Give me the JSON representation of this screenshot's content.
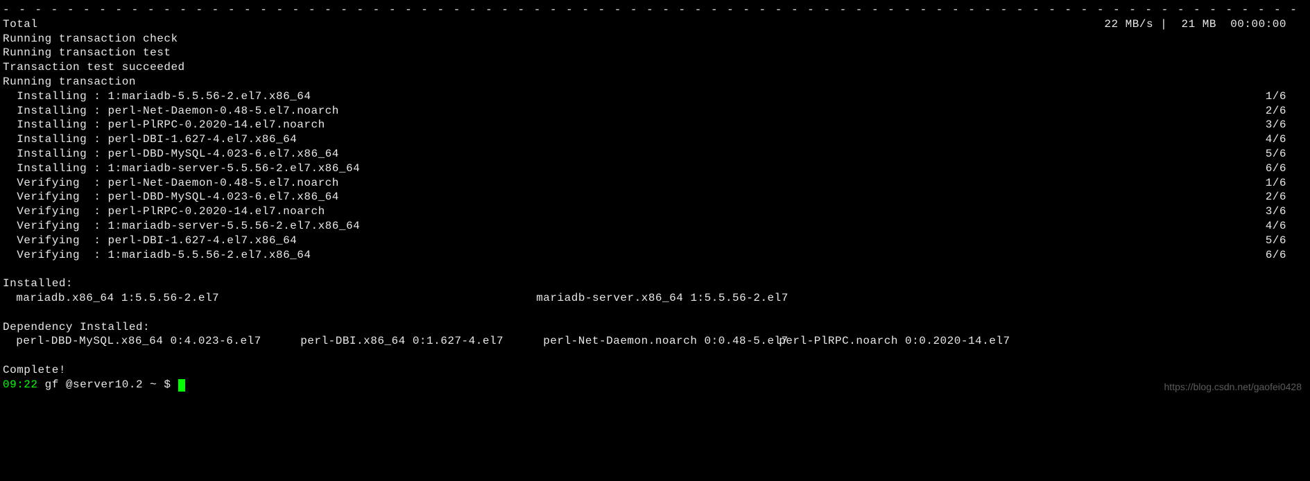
{
  "divider": "- - - - - - - - - - - - - - - - - - - - - - - - - - - - - - - - - - - - - - - - - - - - - - - - - - - - - - - - - - - - - - - - - - - - - - - - - - - - - - - - - - - - - - - - - - - - - - - - - - - - - - - - - - - - - - - - - - - - - - - - - - - - - - - - - - - - - - - - - - - - - - - - - - - - - - - - - - - - - - - - - - - - - - - - - - - - - - - - - - - - - - - - - - - - - - - - - - - - - - - - - - - - - - - - - - - - - - - - - - - - - -",
  "total": {
    "label": "Total",
    "stats": "22 MB/s |  21 MB  00:00:00"
  },
  "status": {
    "check": "Running transaction check",
    "test": "Running transaction test",
    "succeeded": "Transaction test succeeded",
    "running": "Running transaction"
  },
  "install": [
    {
      "left": "  Installing : 1:mariadb-5.5.56-2.el7.x86_64",
      "right": "1/6"
    },
    {
      "left": "  Installing : perl-Net-Daemon-0.48-5.el7.noarch",
      "right": "2/6"
    },
    {
      "left": "  Installing : perl-PlRPC-0.2020-14.el7.noarch",
      "right": "3/6"
    },
    {
      "left": "  Installing : perl-DBI-1.627-4.el7.x86_64",
      "right": "4/6"
    },
    {
      "left": "  Installing : perl-DBD-MySQL-4.023-6.el7.x86_64",
      "right": "5/6"
    },
    {
      "left": "  Installing : 1:mariadb-server-5.5.56-2.el7.x86_64",
      "right": "6/6"
    }
  ],
  "verify": [
    {
      "left": "  Verifying  : perl-Net-Daemon-0.48-5.el7.noarch",
      "right": "1/6"
    },
    {
      "left": "  Verifying  : perl-DBD-MySQL-4.023-6.el7.x86_64",
      "right": "2/6"
    },
    {
      "left": "  Verifying  : perl-PlRPC-0.2020-14.el7.noarch",
      "right": "3/6"
    },
    {
      "left": "  Verifying  : 1:mariadb-server-5.5.56-2.el7.x86_64",
      "right": "4/6"
    },
    {
      "left": "  Verifying  : perl-DBI-1.627-4.el7.x86_64",
      "right": "5/6"
    },
    {
      "left": "  Verifying  : 1:mariadb-5.5.56-2.el7.x86_64",
      "right": "6/6"
    }
  ],
  "installed": {
    "header": "Installed:",
    "pkg1": "mariadb.x86_64 1:5.5.56-2.el7",
    "pkg2": "mariadb-server.x86_64 1:5.5.56-2.el7"
  },
  "depinstalled": {
    "header": "Dependency Installed:",
    "pkg1": "perl-DBD-MySQL.x86_64 0:4.023-6.el7",
    "pkg2": "perl-DBI.x86_64 0:1.627-4.el7",
    "pkg3": "perl-Net-Daemon.noarch 0:0.48-5.el7",
    "pkg4": "perl-PlRPC.noarch 0:0.2020-14.el7"
  },
  "complete": "Complete!",
  "prompt": {
    "time": "09:22",
    "rest": " gf @server10.2 ~ $ "
  },
  "watermark": "https://blog.csdn.net/gaofei0428"
}
